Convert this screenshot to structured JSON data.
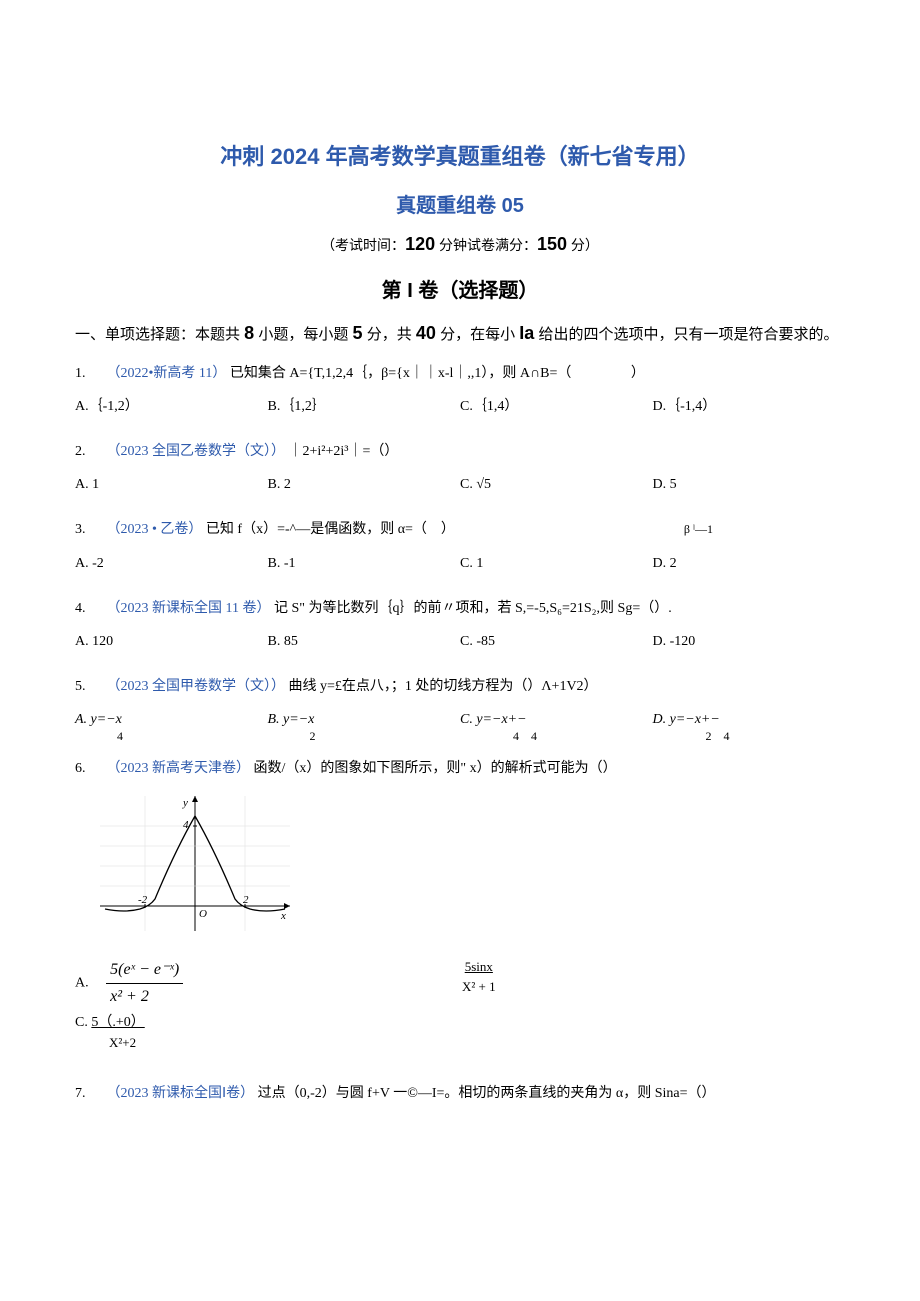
{
  "header": {
    "title_main": "冲刺 2024 年高考数学真题重组卷（新七省专用）",
    "title_sub": "真题重组卷 05",
    "exam_info_pre": "（考试时间：",
    "exam_info_time": "120",
    "exam_info_mid": " 分钟试卷满分：",
    "exam_info_score": "150",
    "exam_info_post": " 分）",
    "section": "第 I 卷（选择题）",
    "instr_a": "一、单项选择题：本题共 ",
    "instr_b": "8",
    "instr_c": " 小题，每小题 ",
    "instr_d": "5",
    "instr_e": " 分，共 ",
    "instr_f": "40",
    "instr_g": " 分，在每小 ",
    "instr_h": "Ia",
    "instr_i": " 给出的四个选项中，只有一项是符合要求的。"
  },
  "q1": {
    "num": "1.",
    "source": "（2022•新高考 11）",
    "stem": "已知集合 A={T,1,2,4｛，β={x｜｜x-l｜,,1），则 A∩B=（",
    "paren": "　　　　）",
    "A": "A.｛-1,2）",
    "B": "B.｛1,2｝",
    "C": "C.｛1,4）",
    "D": "D.｛-1,4）"
  },
  "q2": {
    "num": "2.",
    "source": "（2023 全国乙卷数学（文））",
    "stem": "｜2+i²+2i³｜=（）",
    "A": "A. 1",
    "B": "B. 2",
    "C": "C. √5",
    "D": "D. 5"
  },
  "q3": {
    "num": "3.",
    "source": "（2023 • 乙卷）",
    "stem_a": "已知 f（x）=-^—是偶函数，则 α=（　）",
    "stem_b": "β ˡ—1",
    "A": "A. -2",
    "B": "B. -1",
    "C": "C. 1",
    "D": "D. 2"
  },
  "q4": {
    "num": "4.",
    "source": "（2023 新课标全国 11 卷）",
    "stem": "记 S\" 为等比数列｛q｝的前〃项和，若 S,=-5,S₆=21S₂,则 Sg=（）.",
    "A": "A. 120",
    "B": "B. 85",
    "C": "C. -85",
    "D": "D. -120"
  },
  "q5": {
    "num": "5.",
    "source": "（2023 全国甲卷数学（文））",
    "stem": "曲线 y=£在点八，；1 处的切线方程为（）Ʌ+1V2）",
    "A_a": "A. y=−x",
    "A_b": "4",
    "B_a": "B. y=−x",
    "B_b": "2",
    "C_a": "C. y=−x+−",
    "C_b": "4　4",
    "D_a": "D. y=−x+−",
    "D_b": "2　4"
  },
  "q6": {
    "num": "6.",
    "source": "（2023 新高考天津卷）",
    "stem": "函数/（x）的图象如下图所示，则\" x）的解析式可能为（）",
    "A_prefix": "A.　",
    "A_num": "5(eˣ − e⁻ˣ)",
    "A_den": "x² + 2",
    "B_num": "5sinx",
    "B_den": "X² + 1",
    "C_label": "C. ",
    "C_num": "5（.+0）",
    "C_den": "X²+2"
  },
  "q7": {
    "num": "7.",
    "source": "（2023 新课标全国Ⅰ卷）",
    "stem": "过点（0,-2）与圆 f+V 一©—I=。相切的两条直线的夹角为 α，则 Sina=（）"
  }
}
